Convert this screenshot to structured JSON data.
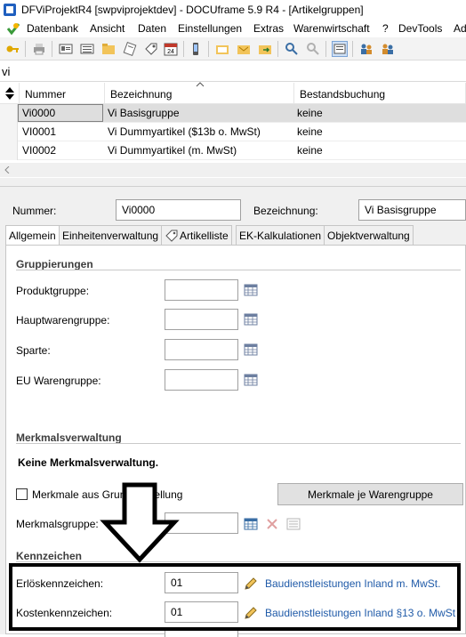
{
  "window": {
    "title": "DFViProjektR4 [swpviprojektdev] - DOCUframe 5.9 R4 - [Artikelgruppen]"
  },
  "menu": {
    "items": [
      "Datenbank",
      "Ansicht",
      "Daten",
      "Einstellungen",
      "Extras",
      "Warenwirtschaft",
      "?",
      "DevTools",
      "Ad"
    ]
  },
  "search": {
    "value": "vi"
  },
  "grid": {
    "columns": [
      "Nummer",
      "Bezeichnung",
      "Bestandsbuchung"
    ],
    "rows": [
      {
        "nummer": "Vi0000",
        "bezeichnung": "Vi Basisgruppe",
        "bestandsbuchung": "keine"
      },
      {
        "nummer": "VI0001",
        "bezeichnung": "Vi Dummyartikel ($13b o. MwSt)",
        "bestandsbuchung": "keine"
      },
      {
        "nummer": "VI0002",
        "bezeichnung": "Vi Dummyartikel (m. MwSt)",
        "bestandsbuchung": "keine"
      }
    ]
  },
  "detail": {
    "nummer_label": "Nummer:",
    "nummer_value": "Vi0000",
    "bezeichnung_label": "Bezeichnung:",
    "bezeichnung_value": "Vi Basisgruppe"
  },
  "tabs": [
    "Allgemein",
    "Einheitenverwaltung",
    "Artikelliste",
    "EK-Kalkulationen",
    "Objektverwaltung"
  ],
  "gruppierungen": {
    "title": "Gruppierungen",
    "fields": [
      {
        "label": "Produktgruppe:",
        "value": ""
      },
      {
        "label": "Hauptwarengruppe:",
        "value": ""
      },
      {
        "label": "Sparte:",
        "value": ""
      },
      {
        "label": "EU Warengruppe:",
        "value": ""
      }
    ]
  },
  "merkmale": {
    "title": "Merkmalsverwaltung",
    "notice": "Keine Merkmalsverwaltung.",
    "checkbox_label": "Merkmale aus Grundeinstellung",
    "button_label": "Merkmale je Warengruppe",
    "gruppe_label": "Merkmalsgruppe:",
    "gruppe_value": ""
  },
  "kennzeichen": {
    "title": "Kennzeichen",
    "erloes_label": "Erlöskennzeichen:",
    "erloes_value": "01",
    "erloes_link": "Baudienstleistungen Inland m. MwSt.",
    "kosten_label": "Kostenkennzeichen:",
    "kosten_value": "01",
    "kosten_link": "Baudienstleistungen Inland §13 o. MwSt"
  },
  "colors": {
    "link": "#1f5aa8",
    "selected_row": "#dedede",
    "annotation": "#000000"
  }
}
